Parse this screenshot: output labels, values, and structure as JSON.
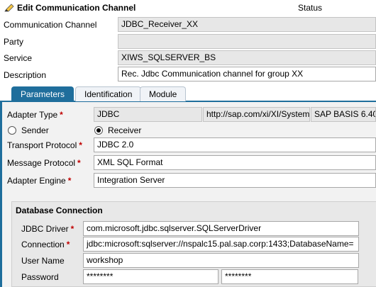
{
  "window": {
    "title": "Edit Communication Channel",
    "status_label": "Status"
  },
  "header_fields": [
    {
      "label": "Communication Channel",
      "value": "JDBC_Receiver_XX"
    },
    {
      "label": "Party",
      "value": ""
    },
    {
      "label": "Service",
      "value": "XIWS_SQLSERVER_BS"
    },
    {
      "label": "Description",
      "value": "Rec. Jdbc Communication channel for group XX"
    }
  ],
  "tabs": [
    {
      "label": "Parameters",
      "active": true
    },
    {
      "label": "Identification",
      "active": false
    },
    {
      "label": "Module",
      "active": false
    }
  ],
  "parameters": {
    "adapter_type": {
      "label": "Adapter Type",
      "value": "JDBC",
      "namespace": "http://sap.com/xi/XI/System",
      "software_component": "SAP BASIS 6.40"
    },
    "direction": {
      "sender_label": "Sender",
      "receiver_label": "Receiver",
      "selected": "Receiver"
    },
    "transport_protocol": {
      "label": "Transport Protocol",
      "value": "JDBC 2.0"
    },
    "message_protocol": {
      "label": "Message Protocol",
      "value": "XML SQL Format"
    },
    "adapter_engine": {
      "label": "Adapter Engine",
      "value": "Integration Server"
    }
  },
  "database_connection": {
    "title": "Database Connection",
    "jdbc_driver": {
      "label": "JDBC Driver",
      "value": "com.microsoft.jdbc.sqlserver.SQLServerDriver"
    },
    "connection": {
      "label": "Connection",
      "value": "jdbc:microsoft:sqlserver://nspalc15.pal.sap.corp:1433;DatabaseName="
    },
    "user_name": {
      "label": "User Name",
      "value": "workshop"
    },
    "password": {
      "label": "Password",
      "value": "********",
      "confirm_value": "********"
    }
  },
  "required_marker": "*",
  "colors": {
    "accent": "#1f6e9c",
    "required": "#c00000",
    "panel_bg": "#f2f2f2"
  }
}
